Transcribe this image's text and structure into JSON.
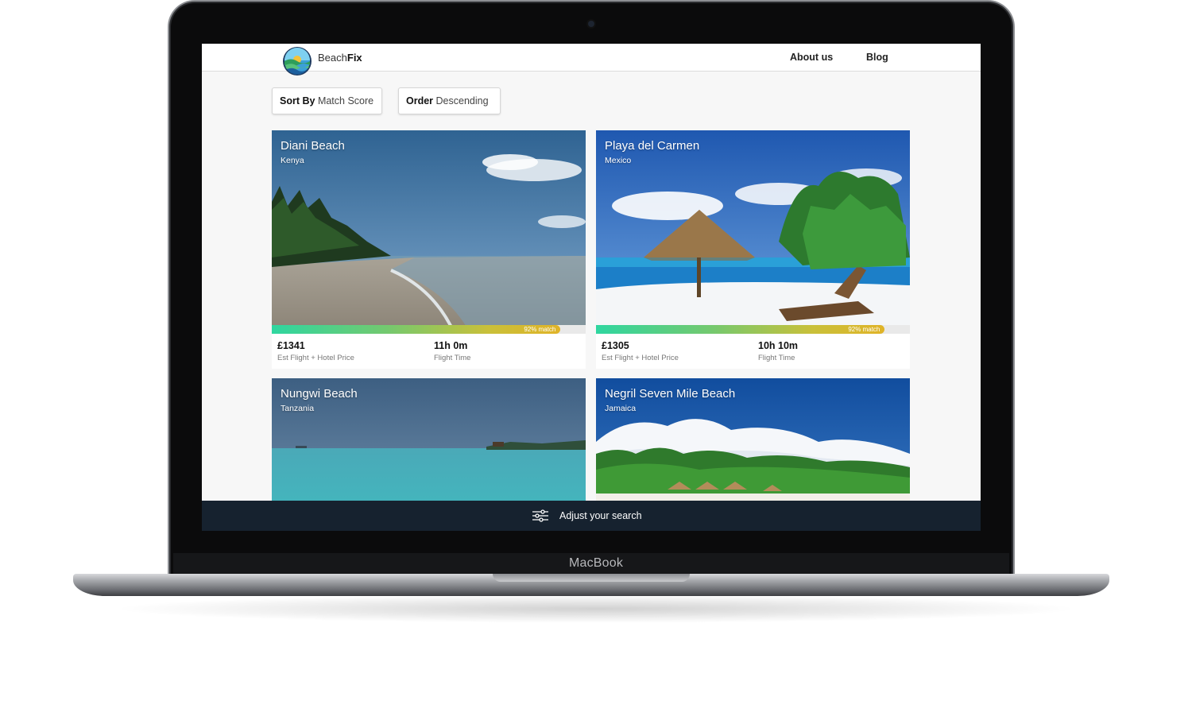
{
  "device": {
    "brand_label": "MacBook"
  },
  "header": {
    "logo": {
      "icon": "beach-logo-icon",
      "text_light": "Beach",
      "text_bold": "Fix"
    },
    "nav": [
      {
        "label": "About us"
      },
      {
        "label": "Blog"
      }
    ]
  },
  "controls": {
    "sort": {
      "key": "Sort By",
      "value": "Match Score"
    },
    "order": {
      "key": "Order",
      "value": "Descending"
    }
  },
  "results": [
    {
      "name": "Diani Beach",
      "country": "Kenya",
      "match_percent": 92,
      "match_label": "92% match",
      "price": "£1341",
      "price_label": "Est Flight + Hotel Price",
      "flight_time": "11h 0m",
      "flight_label": "Flight Time"
    },
    {
      "name": "Playa del Carmen",
      "country": "Mexico",
      "match_percent": 92,
      "match_label": "92% match",
      "price": "£1305",
      "price_label": "Est Flight + Hotel Price",
      "flight_time": "10h 10m",
      "flight_label": "Flight Time"
    },
    {
      "name": "Nungwi Beach",
      "country": "Tanzania"
    },
    {
      "name": "Negril Seven Mile Beach",
      "country": "Jamaica"
    }
  ],
  "bottom_bar": {
    "icon": "sliders-icon",
    "label": "Adjust your search"
  },
  "colors": {
    "bottom_bar": "#16222f",
    "match_start": "#2fd6a0",
    "match_end": "#e0b327"
  }
}
